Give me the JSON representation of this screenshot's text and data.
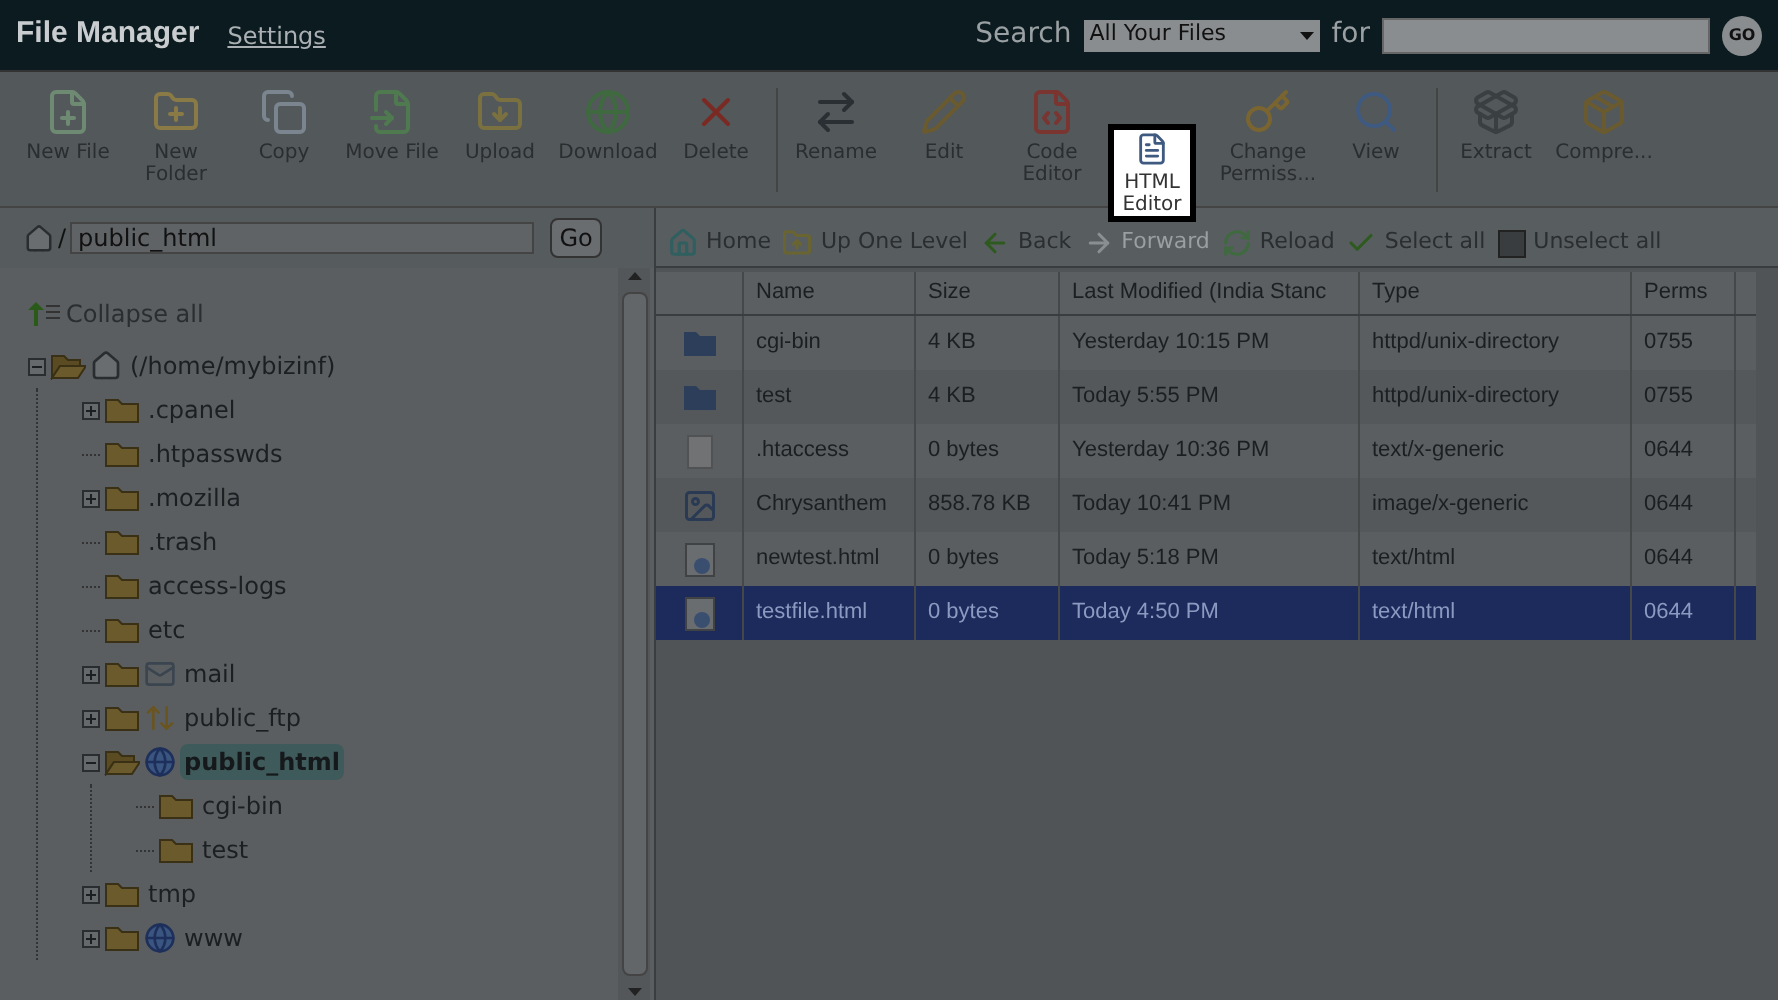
{
  "header": {
    "title": "File Manager",
    "settings_link": "Settings",
    "search_label": "Search",
    "search_scope": "All Your Files",
    "for_label": "for",
    "go_button": "GO"
  },
  "toolbar_groups": [
    [
      {
        "label": "New File",
        "kind": "new-file",
        "highlighted": false
      },
      {
        "label": "New Folder",
        "kind": "new-folder",
        "highlighted": false
      },
      {
        "label": "Copy",
        "kind": "copy",
        "highlighted": false
      },
      {
        "label": "Move File",
        "kind": "move",
        "highlighted": false
      },
      {
        "label": "Upload",
        "kind": "upload",
        "highlighted": false
      },
      {
        "label": "Download",
        "kind": "download",
        "highlighted": false
      },
      {
        "label": "Delete",
        "kind": "delete",
        "highlighted": false
      }
    ],
    [
      {
        "label": "Rename",
        "kind": "rename",
        "highlighted": false
      },
      {
        "label": "Edit",
        "kind": "edit",
        "highlighted": false
      },
      {
        "label": "Code Editor",
        "kind": "code",
        "highlighted": false
      },
      {
        "label": "HTML Editor",
        "kind": "html",
        "highlighted": true
      },
      {
        "label": "Change Permiss...",
        "kind": "key",
        "highlighted": false
      },
      {
        "label": "View",
        "kind": "view",
        "highlighted": false
      }
    ],
    [
      {
        "label": "Extract",
        "kind": "extract",
        "highlighted": false
      },
      {
        "label": "Compre...",
        "kind": "compress",
        "highlighted": false
      }
    ]
  ],
  "path_bar": {
    "separator": "/",
    "value": "public_html",
    "go_button": "Go"
  },
  "collapse_all": "Collapse all",
  "tree": [
    {
      "label": "(/home/mybizinf)",
      "kind": "home",
      "expanded": true,
      "selected": false,
      "children": [
        {
          "label": ".cpanel",
          "kind": "folder",
          "expanded": false,
          "selected": false
        },
        {
          "label": ".htpasswds",
          "kind": "leaf",
          "selected": false
        },
        {
          "label": ".mozilla",
          "kind": "folder",
          "expanded": false,
          "selected": false
        },
        {
          "label": ".trash",
          "kind": "leaf",
          "selected": false
        },
        {
          "label": "access-logs",
          "kind": "leaf",
          "selected": false
        },
        {
          "label": "etc",
          "kind": "leaf",
          "selected": false
        },
        {
          "label": "mail",
          "kind": "mail",
          "expanded": false,
          "selected": false
        },
        {
          "label": "public_ftp",
          "kind": "ftp",
          "expanded": false,
          "selected": false
        },
        {
          "label": "public_html",
          "kind": "globe",
          "expanded": true,
          "selected": true,
          "children": [
            {
              "label": "cgi-bin",
              "kind": "leaf",
              "selected": false
            },
            {
              "label": "test",
              "kind": "leaf",
              "selected": false
            }
          ]
        },
        {
          "label": "tmp",
          "kind": "folder",
          "expanded": false,
          "selected": false
        },
        {
          "label": "www",
          "kind": "globe",
          "expanded": false,
          "selected": false
        }
      ]
    }
  ],
  "nav": [
    {
      "label": "Home",
      "kind": "home",
      "disabled": false
    },
    {
      "label": "Up One Level",
      "kind": "up",
      "disabled": false
    },
    {
      "label": "Back",
      "kind": "back",
      "disabled": false
    },
    {
      "label": "Forward",
      "kind": "forward",
      "disabled": true
    },
    {
      "label": "Reload",
      "kind": "reload",
      "disabled": false
    },
    {
      "label": "Select all",
      "kind": "check",
      "disabled": false
    },
    {
      "label": "Unselect all",
      "kind": "uncheck",
      "disabled": false
    }
  ],
  "table": {
    "columns": [
      "Name",
      "Size",
      "Last Modified (India Stanc",
      "Type",
      "Perms"
    ],
    "rows": [
      {
        "kind": "folder",
        "name": "cgi-bin",
        "size": "4 KB",
        "modified": "Yesterday 10:15 PM",
        "type": "httpd/unix-directory",
        "perms": "0755",
        "selected": false
      },
      {
        "kind": "folder",
        "name": "test",
        "size": "4 KB",
        "modified": "Today 5:55 PM",
        "type": "httpd/unix-directory",
        "perms": "0755",
        "selected": false
      },
      {
        "kind": "text",
        "name": ".htaccess",
        "size": "0 bytes",
        "modified": "Yesterday 10:36 PM",
        "type": "text/x-generic",
        "perms": "0644",
        "selected": false
      },
      {
        "kind": "image",
        "name": "Chrysanthem",
        "size": "858.78 KB",
        "modified": "Today 10:41 PM",
        "type": "image/x-generic",
        "perms": "0644",
        "selected": false
      },
      {
        "kind": "html",
        "name": "newtest.html",
        "size": "0 bytes",
        "modified": "Today 5:18 PM",
        "type": "text/html",
        "perms": "0644",
        "selected": false
      },
      {
        "kind": "html",
        "name": "testfile.html",
        "size": "0 bytes",
        "modified": "Today 4:50 PM",
        "type": "text/html",
        "perms": "0644",
        "selected": true
      }
    ]
  }
}
